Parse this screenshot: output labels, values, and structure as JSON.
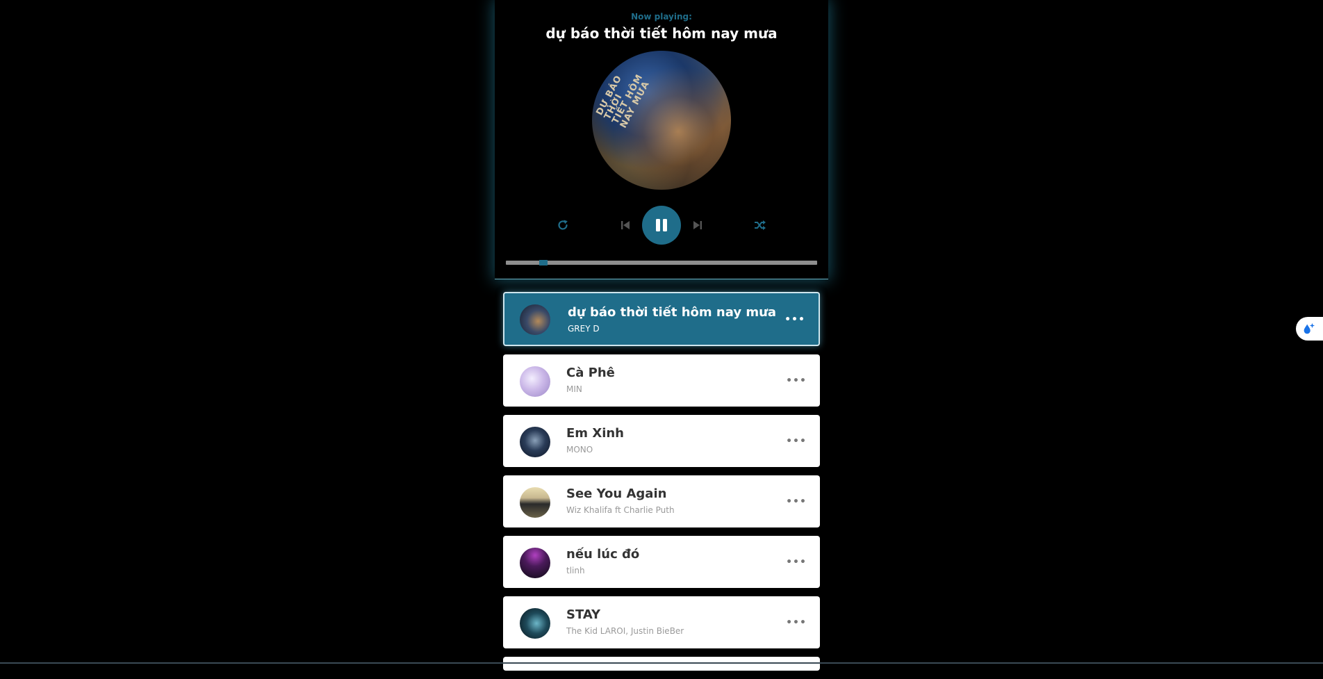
{
  "dashboard": {
    "now_playing_label": "Now playing:",
    "current_title": "dự báo thời tiết hôm nay mưa",
    "cd_text": "DỰ BÁO THỜI TIẾT HÔM NAY MƯA"
  },
  "controls": {
    "repeat_icon": "repeat-icon",
    "prev_icon": "step-backward-icon",
    "play_icon": "pause-icon",
    "next_icon": "step-forward-icon",
    "shuffle_icon": "shuffle-icon"
  },
  "progress": {
    "value": 0.11
  },
  "colors": {
    "accent": "#1f6d8a",
    "background": "#000000",
    "card": "#ffffff"
  },
  "playlist": [
    {
      "title": "dự báo thời tiết hôm nay mưa",
      "author": "GREY D",
      "active": true
    },
    {
      "title": "Cà Phê",
      "author": "MIN",
      "active": false
    },
    {
      "title": "Em Xinh",
      "author": "MONO",
      "active": false
    },
    {
      "title": "See You Again",
      "author": "Wiz Khalifa ft Charlie Puth",
      "active": false
    },
    {
      "title": "nếu lúc đó",
      "author": "tlinh",
      "active": false
    },
    {
      "title": "STAY",
      "author": "The Kid LAROI, Justin BieBer",
      "active": false
    }
  ],
  "side_widget": {
    "icon": "water-drop-sparkle-icon"
  }
}
